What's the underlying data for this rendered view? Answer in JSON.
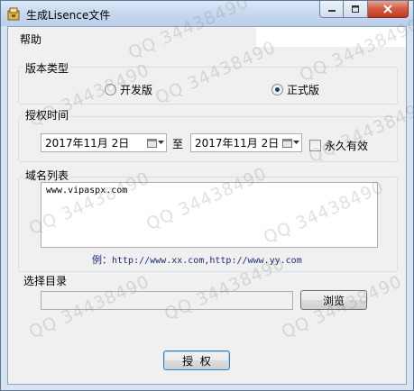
{
  "window": {
    "title": "生成Lisence文件"
  },
  "menu": {
    "help": "帮助"
  },
  "version": {
    "group_title": "版本类型",
    "options": [
      {
        "label": "开发版",
        "checked": false
      },
      {
        "label": "正式版",
        "checked": true
      }
    ]
  },
  "auth_time": {
    "group_title": "授权时间",
    "start_date": "2017年11月 2日",
    "to_label": "至",
    "end_date": "2017年11月 2日",
    "permanent_label": "永久有效",
    "permanent_checked": false
  },
  "domains": {
    "group_title": "域名列表",
    "value": "www.vipaspx.com",
    "example_prefix": "例：",
    "example_text": "http://www.xx.com,http://www.yy.com"
  },
  "directory": {
    "label": "选择目录",
    "path": "",
    "browse_label": "浏览"
  },
  "actions": {
    "authorize_label": "授  权"
  },
  "watermark": {
    "text": "QQ 34438490"
  },
  "icons": {
    "app": "app-icon",
    "minimize": "minimize-icon",
    "maximize": "maximize-icon",
    "close": "close-icon",
    "calendar": "calendar-icon",
    "dropdown": "chevron-down-icon"
  }
}
